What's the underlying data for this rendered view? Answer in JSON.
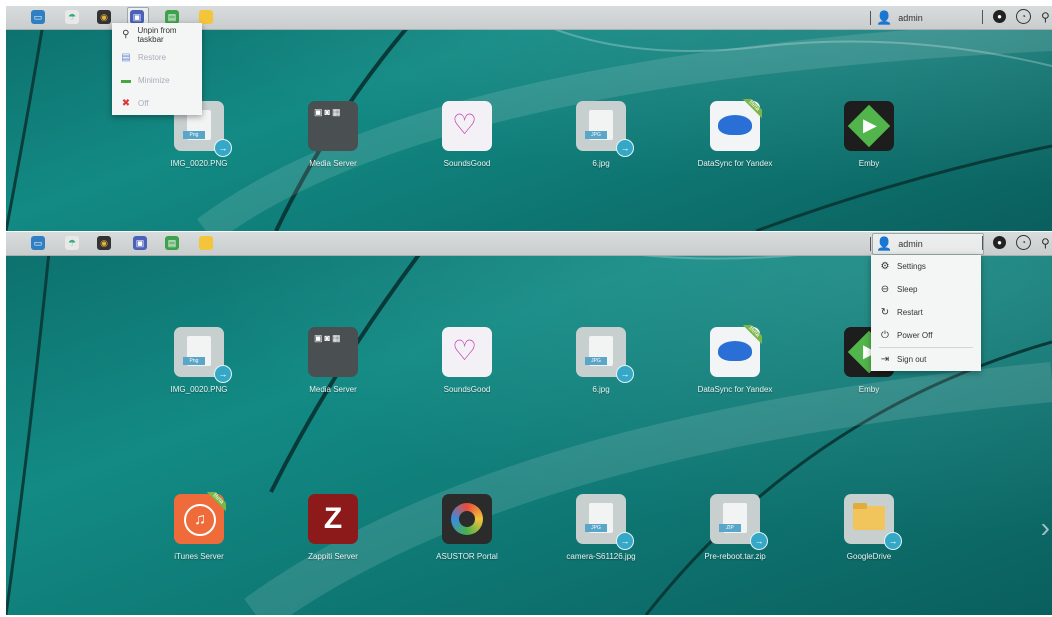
{
  "taskbar_icons": [
    "desktop-icon",
    "network-icon",
    "backup-icon",
    "media-icon",
    "calendar-icon",
    "notes-icon"
  ],
  "colors": {
    "accent": "#138a84",
    "taskbar": "#d0d4d4",
    "file_tag": "#5aa6c9",
    "beta": "#7ab648"
  },
  "user": {
    "name": "admin"
  },
  "context_menu": {
    "items": [
      {
        "label": "Unpin from taskbar",
        "icon": "pin-icon",
        "enabled": true
      },
      {
        "label": "Restore",
        "icon": "restore-icon",
        "enabled": false
      },
      {
        "label": "Minimize",
        "icon": "minimize-icon",
        "enabled": false
      },
      {
        "label": "Off",
        "icon": "close-icon",
        "enabled": false
      }
    ]
  },
  "user_menu": {
    "items": [
      {
        "label": "Settings",
        "icon": "gear-icon"
      },
      {
        "label": "Sleep",
        "icon": "sleep-icon"
      },
      {
        "label": "Restart",
        "icon": "restart-icon"
      },
      {
        "label": "Power Off",
        "icon": "power-icon"
      },
      {
        "label": "Sign out",
        "icon": "sign-out-icon"
      }
    ]
  },
  "desktop_row1": [
    {
      "label": "IMG_0020.PNG",
      "type": "file",
      "tag": "Png"
    },
    {
      "label": "Media Server",
      "type": "app"
    },
    {
      "label": "SoundsGood",
      "type": "app"
    },
    {
      "label": "6.jpg",
      "type": "file",
      "tag": "JPG"
    },
    {
      "label": "DataSync for Yandex",
      "type": "app",
      "badge": "Beta"
    },
    {
      "label": "Emby",
      "type": "app"
    }
  ],
  "desktop_row2": [
    {
      "label": "iTunes Server",
      "type": "app",
      "badge": "Beta"
    },
    {
      "label": "Zappiti Server",
      "type": "app"
    },
    {
      "label": "ASUSTOR Portal",
      "type": "app"
    },
    {
      "label": "camera-S61126.jpg",
      "type": "file",
      "tag": "JPG"
    },
    {
      "label": "Pre-reboot.tar.zip",
      "type": "file",
      "tag": "ZIP"
    },
    {
      "label": "GoogleDrive",
      "type": "app"
    }
  ]
}
